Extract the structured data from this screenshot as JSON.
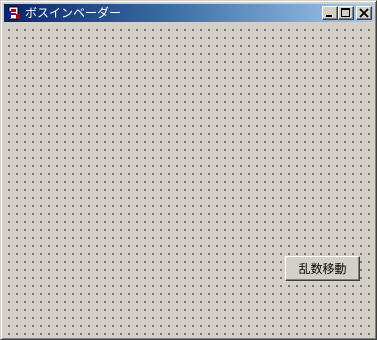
{
  "window": {
    "title": "ボスインベーダー",
    "controls": {
      "minimize": "minimize-icon",
      "maximize": "maximize-icon",
      "close": "close-icon"
    },
    "titlebar_colors": [
      "#0a246a",
      "#a6caf0"
    ]
  },
  "client": {
    "background": "#d4d0c8",
    "dot_color": "#000000",
    "random_move_button": "乱数移動"
  }
}
